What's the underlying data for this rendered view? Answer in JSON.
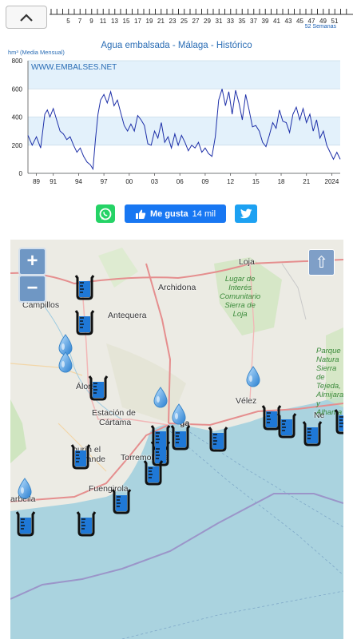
{
  "topbar": {
    "week_labels": [
      "5",
      "7",
      "9",
      "11",
      "13",
      "15",
      "17",
      "19",
      "21",
      "23",
      "25",
      "27",
      "29",
      "31",
      "33",
      "35",
      "37",
      "39",
      "41",
      "43",
      "45",
      "47",
      "49",
      "51"
    ],
    "weeks_caption": "52 Semanas"
  },
  "chart": {
    "title": "Agua embalsada - Málaga - Histórico",
    "unit_label": "hm³ (Media Mensual)",
    "watermark": "WWW.EMBALSES.NET",
    "band_color": "#e3f1fb",
    "line_color": "#1d2fa8"
  },
  "chart_data": {
    "type": "line",
    "title": "Agua embalsada - Málaga - Histórico",
    "ylabel": "hm³ (Media Mensual)",
    "ylim": [
      0,
      800
    ],
    "yticks": [
      0,
      200,
      400,
      600,
      800
    ],
    "xlim": [
      1988,
      2025
    ],
    "xticks": [
      "89",
      "91",
      "94",
      "97",
      "00",
      "03",
      "06",
      "09",
      "12",
      "15",
      "18",
      "21",
      "2024"
    ],
    "xtick_values": [
      1989,
      1991,
      1994,
      1997,
      2000,
      2003,
      2006,
      2009,
      2012,
      2015,
      2018,
      2021,
      2024
    ],
    "series": [
      {
        "x": [
          1988.0,
          1988.5,
          1989.0,
          1989.5,
          1990.0,
          1990.3,
          1990.6,
          1991.0,
          1991.4,
          1991.8,
          1992.2,
          1992.6,
          1993.0,
          1993.4,
          1993.8,
          1994.2,
          1994.6,
          1995.0,
          1995.4,
          1995.7,
          1996.0,
          1996.3,
          1996.6,
          1997.0,
          1997.4,
          1997.8,
          1998.2,
          1998.6,
          1999.0,
          1999.4,
          1999.8,
          2000.2,
          2000.6,
          2001.0,
          2001.4,
          2001.8,
          2002.2,
          2002.6,
          2003.0,
          2003.4,
          2003.8,
          2004.2,
          2004.6,
          2005.0,
          2005.4,
          2005.8,
          2006.2,
          2006.6,
          2007.0,
          2007.4,
          2007.8,
          2008.2,
          2008.6,
          2009.0,
          2009.4,
          2009.8,
          2010.2,
          2010.6,
          2011.0,
          2011.4,
          2011.8,
          2012.2,
          2012.6,
          2013.0,
          2013.4,
          2013.8,
          2014.2,
          2014.6,
          2015.0,
          2015.4,
          2015.8,
          2016.2,
          2016.6,
          2017.0,
          2017.4,
          2017.8,
          2018.2,
          2018.6,
          2019.0,
          2019.4,
          2019.8,
          2020.2,
          2020.6,
          2021.0,
          2021.4,
          2021.8,
          2022.2,
          2022.6,
          2023.0,
          2023.4,
          2023.8,
          2024.2,
          2024.6,
          2025.0
        ],
        "y": [
          270,
          200,
          260,
          180,
          420,
          450,
          400,
          460,
          380,
          300,
          280,
          240,
          260,
          200,
          150,
          180,
          120,
          80,
          60,
          30,
          240,
          420,
          520,
          560,
          500,
          580,
          480,
          520,
          430,
          340,
          300,
          350,
          300,
          410,
          380,
          340,
          210,
          200,
          300,
          250,
          360,
          220,
          260,
          180,
          280,
          200,
          270,
          220,
          160,
          200,
          180,
          220,
          150,
          180,
          140,
          120,
          260,
          520,
          600,
          480,
          580,
          420,
          590,
          500,
          380,
          560,
          450,
          330,
          340,
          300,
          220,
          190,
          270,
          360,
          320,
          450,
          370,
          360,
          290,
          420,
          470,
          380,
          460,
          360,
          420,
          300,
          380,
          250,
          300,
          200,
          150,
          100,
          150,
          100
        ]
      }
    ]
  },
  "social": {
    "like_label": "Me gusta",
    "like_count": "14 mil"
  },
  "map": {
    "zoom_in": "+",
    "zoom_out": "−",
    "up_symbol": "⇧",
    "places": {
      "loja": "Loja",
      "archidona": "Archidona",
      "campillos": "Campillos",
      "antequera": "Antequera",
      "alora": "Álora",
      "estacion": "Estación de",
      "cartama": "Cártama",
      "malaga": "ga",
      "alhaurin": "hurín el",
      "grande": "Grande",
      "torremolinos": "Torremolinos",
      "fuengirola": "Fuengirola",
      "marbella": "arbella",
      "velez": "Vélez",
      "nerja": "Ne"
    },
    "park_loja": [
      "Lugar de",
      "Interés",
      "Comunitario",
      "Sierra de",
      "Loja"
    ],
    "park_tejeda": [
      "Parque",
      "Natura",
      "Sierra de",
      "Tejeda,",
      "Almijara",
      "y Alhama"
    ]
  }
}
